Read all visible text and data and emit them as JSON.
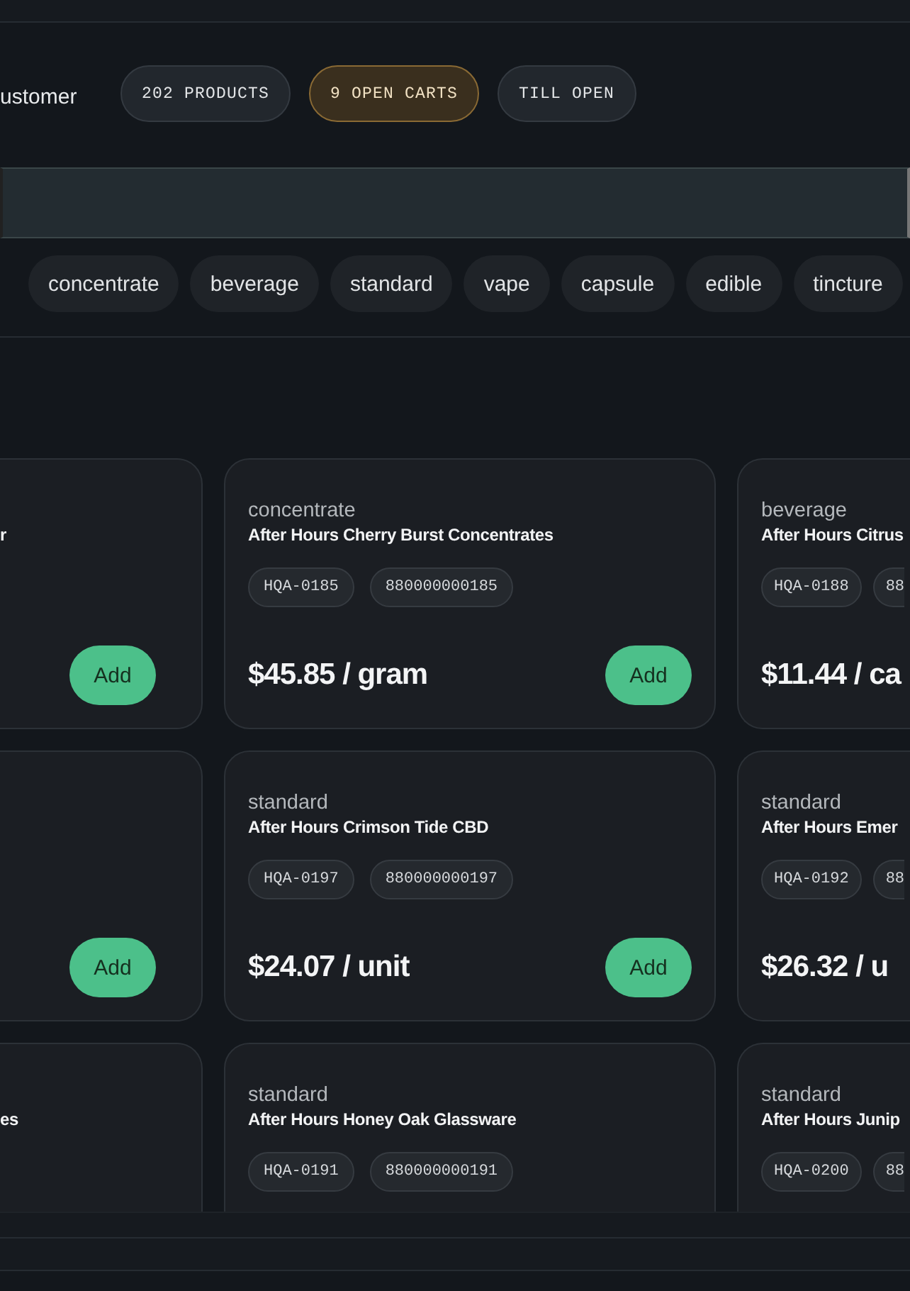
{
  "header": {
    "title": "ustomer",
    "pills": [
      {
        "label": "202 PRODUCTS",
        "kind": "neutral"
      },
      {
        "label": "9 OPEN CARTS",
        "kind": "warning"
      },
      {
        "label": "TILL OPEN",
        "kind": "neutral"
      }
    ]
  },
  "categories": [
    "concentrate",
    "beverage",
    "standard",
    "vape",
    "capsule",
    "edible",
    "tincture"
  ],
  "product_rows": [
    [
      {
        "name": "r",
        "add_button": "Add"
      },
      {
        "category": "concentrate",
        "name": "After Hours Cherry Burst Concentrates",
        "sku": "HQA-0185",
        "barcode": "880000000185",
        "price": "$45.85 / gram",
        "add_button": "Add"
      },
      {
        "category": "beverage",
        "name": "After Hours Citrus",
        "sku": "HQA-0188",
        "barcode": "88",
        "price": "$11.44 / ca"
      }
    ],
    [
      {
        "add_button": "Add"
      },
      {
        "category": "standard",
        "name": "After Hours Crimson Tide CBD",
        "sku": "HQA-0197",
        "barcode": "880000000197",
        "price": "$24.07 / unit",
        "add_button": "Add"
      },
      {
        "category": "standard",
        "name": "After Hours Emer",
        "sku": "HQA-0192",
        "barcode": "88",
        "price": "$26.32 / u"
      }
    ],
    [
      {
        "name": "es"
      },
      {
        "category": "standard",
        "name": "After Hours Honey Oak Glassware",
        "sku": "HQA-0191",
        "barcode": "880000000191"
      },
      {
        "category": "standard",
        "name": "After Hours Junip",
        "sku": "HQA-0200",
        "barcode": "88"
      }
    ]
  ]
}
